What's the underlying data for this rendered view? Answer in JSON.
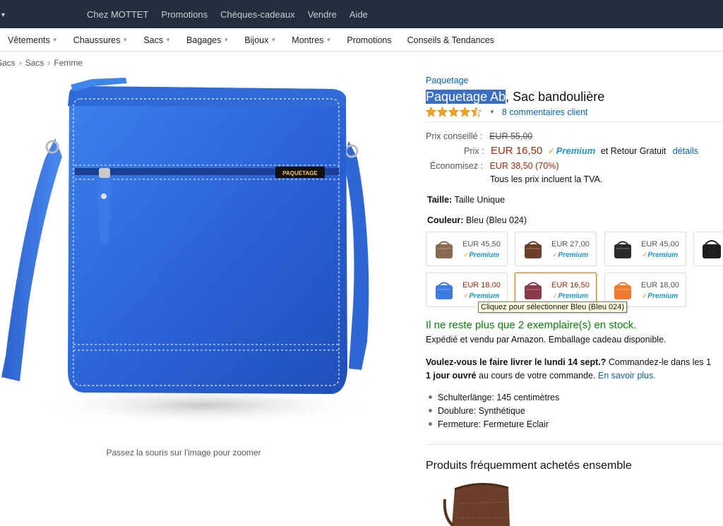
{
  "topnav": {
    "items": [
      "Chez MOTTET",
      "Promotions",
      "Chèques-cadeaux",
      "Vendre",
      "Aide"
    ]
  },
  "catnav": {
    "items": [
      {
        "label": "Vêtements",
        "dropdown": true
      },
      {
        "label": "Chaussures",
        "dropdown": true
      },
      {
        "label": "Sacs",
        "dropdown": true
      },
      {
        "label": "Bagages",
        "dropdown": true
      },
      {
        "label": "Bijoux",
        "dropdown": true
      },
      {
        "label": "Montres",
        "dropdown": true
      },
      {
        "label": "Promotions",
        "dropdown": false
      },
      {
        "label": "Conseils & Tendances",
        "dropdown": false
      }
    ]
  },
  "breadcrumb": [
    "Sacs",
    "Sacs",
    "Femme"
  ],
  "breadcrumb_sep": "›",
  "zoom_hint": "Passez la souris sur l'image pour zoomer",
  "product": {
    "brand": "Paquetage",
    "title_highlight": "Paquetage Ab",
    "title_rest": ", Sac bandoulière",
    "rating": 4.5,
    "reviews": "8 commentaires client",
    "bag_color": "#2f6fe0"
  },
  "pricing": {
    "list_label": "Prix conseillé :",
    "list_value": "EUR 55,00",
    "price_label": "Prix :",
    "price_value": "EUR 16,50",
    "prime": "Premium",
    "shipping": "et Retour Gratuit",
    "details_link": "détails",
    "savings_label": "Économisez :",
    "savings_value": "EUR 38,50 (70%)",
    "tax_note": "Tous les prix incluent la TVA."
  },
  "size": {
    "label": "Taille:",
    "value": "Taille Unique"
  },
  "color": {
    "label": "Couleur:",
    "value": "Bleu (Bleu 024)"
  },
  "swatches": [
    {
      "price": "EUR 45,50",
      "prime": "Premium",
      "color": "#8a6a4e",
      "selected": false,
      "red": false
    },
    {
      "price": "EUR 27,00",
      "prime": "Premium",
      "color": "#6b3f2a",
      "selected": false,
      "red": false
    },
    {
      "price": "EUR 45,00",
      "prime": "Premium",
      "color": "#2b2b2b",
      "selected": false,
      "red": false
    },
    {
      "price": "EUR 18,00",
      "prime": "Premium",
      "color": "#3b7be0",
      "selected": false,
      "red": true
    },
    {
      "price": "EUR 16,50",
      "prime": "Premium",
      "color": "#8a3a4a",
      "selected": true,
      "red": true
    },
    {
      "price": "EUR 18,00",
      "prime": "Premium",
      "color": "#f07a30",
      "selected": false,
      "red": false
    }
  ],
  "tooltip": "Cliquez pour sélectionner Bleu (Bleu 024)",
  "stock": "Il ne reste plus que 2 exemplaire(s) en stock.",
  "sold_by": "Expédié et vendu par Amazon. Emballage cadeau disponible.",
  "delivery": {
    "q_bold": "Voulez-vous le faire livrer le lundi 14 sept.?",
    "q_rest": " Commandez-le dans les 1",
    "day_bold": "1 jour ouvré",
    "day_rest": " au cours de votre commande. ",
    "link": "En savoir plus."
  },
  "features": [
    "Schulterlänge: 145 centimètres",
    "Doublure: Synthétique",
    "Fermeture: Fermeture Eclair"
  ],
  "fbt_title": "Produits fréquemment achetés ensemble"
}
